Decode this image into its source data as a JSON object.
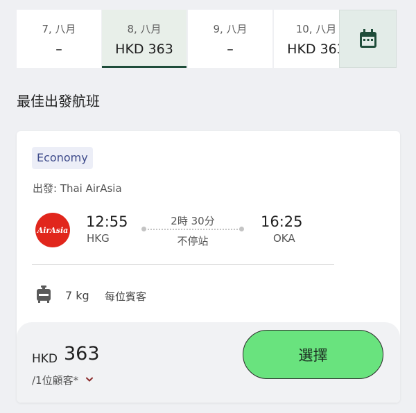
{
  "date_tabs": [
    {
      "label": "7, 八月",
      "price": "–",
      "selected": false
    },
    {
      "label": "8, 八月",
      "price": "HKD 363",
      "selected": true
    },
    {
      "label": "9, 八月",
      "price": "–",
      "selected": false
    },
    {
      "label": "10, 八月",
      "price": "HKD 363",
      "selected": false
    }
  ],
  "calendar_button": {
    "icon": "calendar-icon"
  },
  "section_title": "最佳出發航班",
  "flight": {
    "cabin": "Economy",
    "operator": "出發: Thai AirAsia",
    "airline_logo_text": "AirAsia",
    "departure": {
      "time": "12:55",
      "code": "HKG"
    },
    "arrival": {
      "time": "16:25",
      "code": "OKA"
    },
    "duration": "2時 30分",
    "stops": "不停站",
    "baggage": {
      "icon": "luggage-icon",
      "weight": "7 kg",
      "per": "每位賓客"
    }
  },
  "price": {
    "currency": "HKD",
    "amount": "363",
    "per_customer": "/1位顧客*",
    "select_label": "選擇"
  },
  "colors": {
    "select_button": "#69e37e",
    "selected_tab_bg": "#e8efe9",
    "selected_tab_border": "#1f4d3a",
    "brand_logo": "#e1261c",
    "cabin_badge_text": "#3d4a8a"
  }
}
